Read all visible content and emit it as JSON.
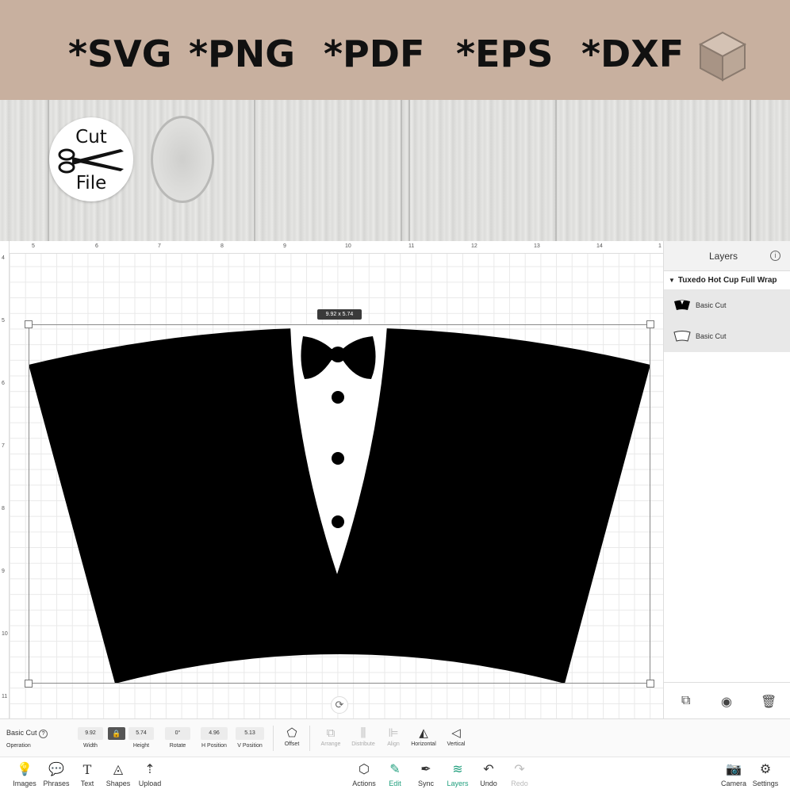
{
  "banner": {
    "formats": [
      "*SVG",
      "*PNG",
      "*PDF",
      "*EPS",
      "*DXF"
    ],
    "cube_icon": "3d-box-icon"
  },
  "badge": {
    "line1": "Cut",
    "line2": "File",
    "icon": "scissors-icon"
  },
  "ruler": {
    "top_ticks": [
      "5",
      "6",
      "7",
      "8",
      "9",
      "10",
      "11",
      "12",
      "13",
      "14",
      "1"
    ],
    "left_ticks": [
      "4",
      "5",
      "6",
      "7",
      "8",
      "9",
      "10",
      "11"
    ]
  },
  "canvas": {
    "size_label": "9.92 x 5.74"
  },
  "layers": {
    "title": "Layers",
    "group_name": "Tuxedo Hot Cup Full Wrap",
    "items": [
      {
        "label": "Basic Cut"
      },
      {
        "label": "Basic Cut"
      }
    ]
  },
  "properties": {
    "operation_value": "Basic Cut",
    "operation_caption": "Operation",
    "width_value": "9.92",
    "width_caption": "Width",
    "height_value": "5.74",
    "height_caption": "Height",
    "rotate_value": "0°",
    "rotate_caption": "Rotate",
    "hpos_value": "4.96",
    "hpos_caption": "H Position",
    "vpos_value": "5.13",
    "vpos_caption": "V Position",
    "offset": "Offset",
    "arrange": "Arrange",
    "distribute": "Distribute",
    "align": "Align",
    "horizontal": "Horizontal",
    "vertical": "Vertical"
  },
  "bottom_toolbar": {
    "images": "Images",
    "phrases": "Phrases",
    "text": "Text",
    "shapes": "Shapes",
    "upload": "Upload",
    "actions": "Actions",
    "edit": "Edit",
    "sync": "Sync",
    "layers": "Layers",
    "undo": "Undo",
    "redo": "Redo",
    "camera": "Camera",
    "settings": "Settings",
    "accent_color": "#1e9e7c"
  }
}
